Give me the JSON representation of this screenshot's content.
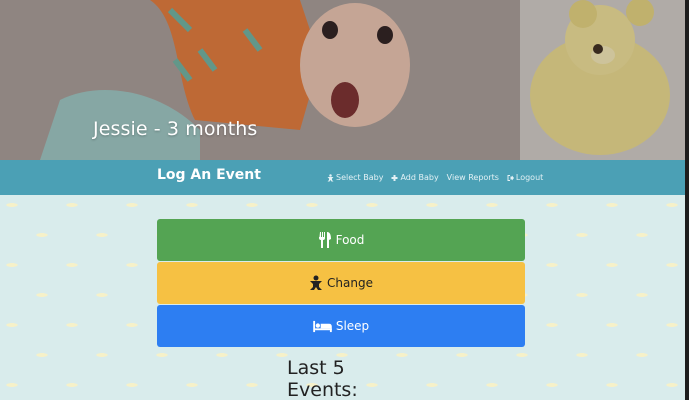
{
  "hero": {
    "title": "Jessie - 3 months",
    "image": "baby-with-teddy-bear-photo"
  },
  "navbar": {
    "brand": "Log An Event",
    "links": [
      {
        "label": "Select Baby",
        "icon": "baby-icon"
      },
      {
        "label": "Add Baby",
        "icon": "plus-icon"
      },
      {
        "label": "View Reports",
        "icon": ""
      },
      {
        "label": "Logout",
        "icon": "logout-icon"
      }
    ]
  },
  "actions": {
    "food": {
      "label": "Food",
      "icon": "cutlery-icon",
      "color": "#54a453"
    },
    "change": {
      "label": "Change",
      "icon": "baby-icon",
      "color": "#f6c143"
    },
    "sleep": {
      "label": "Sleep",
      "icon": "bed-icon",
      "color": "#2d7ef2"
    }
  },
  "events": {
    "heading": "Last 5 Events:"
  },
  "colors": {
    "navbar": "#4ba0b5",
    "background": "#d9ecec"
  }
}
